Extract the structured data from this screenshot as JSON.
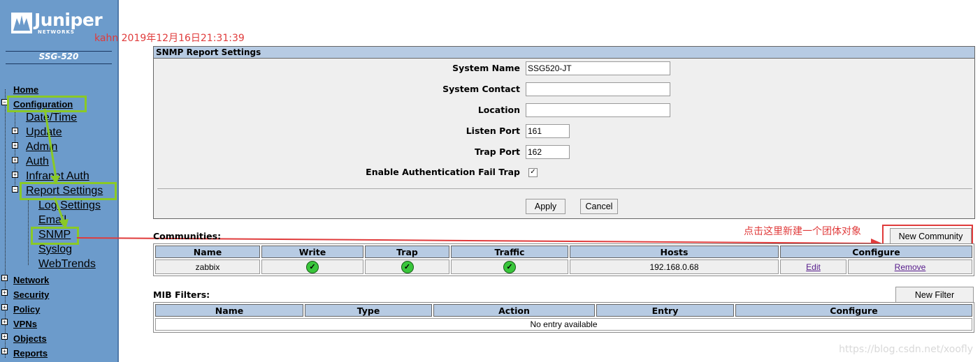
{
  "brand": {
    "logo_text": "Juniper",
    "logo_sub": "NETWORKS",
    "model": "SSG-520"
  },
  "annotation_top": "kahn 2019年12月16日21:31:39",
  "annotation_community": "点击这里新建一个团体对象",
  "watermark": "https://blog.csdn.net/xoofly",
  "nav": {
    "home": "Home",
    "configuration": "Configuration",
    "date_time": "Date/Time",
    "update": "Update",
    "admin": "Admin",
    "auth": "Auth",
    "infranet_auth": "Infranet Auth",
    "report_settings": "Report Settings",
    "log_settings": "Log Settings",
    "email": "Email",
    "snmp": "SNMP",
    "syslog": "Syslog",
    "webtrends": "WebTrends",
    "network": "Network",
    "security": "Security",
    "policy": "Policy",
    "vpns": "VPNs",
    "objects": "Objects",
    "reports": "Reports"
  },
  "snmp_settings": {
    "title": "SNMP Report Settings",
    "system_name_label": "System Name",
    "system_name_value": "SSG520-JT",
    "system_contact_label": "System Contact",
    "system_contact_value": "",
    "location_label": "Location",
    "location_value": "",
    "listen_port_label": "Listen Port",
    "listen_port_value": "161",
    "trap_port_label": "Trap Port",
    "trap_port_value": "162",
    "auth_fail_trap_label": "Enable Authentication Fail Trap",
    "auth_fail_trap_checked": true,
    "apply_label": "Apply",
    "cancel_label": "Cancel"
  },
  "communities": {
    "label": "Communities:",
    "new_button": "New Community",
    "headers": [
      "Name",
      "Write",
      "Trap",
      "Traffic",
      "Hosts",
      "Configure"
    ],
    "rows": [
      {
        "name": "zabbix",
        "write": "✓",
        "trap": "✓",
        "traffic": "✓",
        "hosts": "192.168.0.68",
        "edit": "Edit",
        "remove": "Remove"
      }
    ]
  },
  "mib_filters": {
    "label": "MIB Filters:",
    "new_button": "New Filter",
    "headers": [
      "Name",
      "Type",
      "Action",
      "Entry",
      "Configure"
    ],
    "empty_text": "No entry available"
  },
  "colors": {
    "sidebar": "#6c9bcb",
    "table_header": "#b7cbe3",
    "highlight_green": "#8ac926",
    "annotation_red": "#e03b3b"
  }
}
